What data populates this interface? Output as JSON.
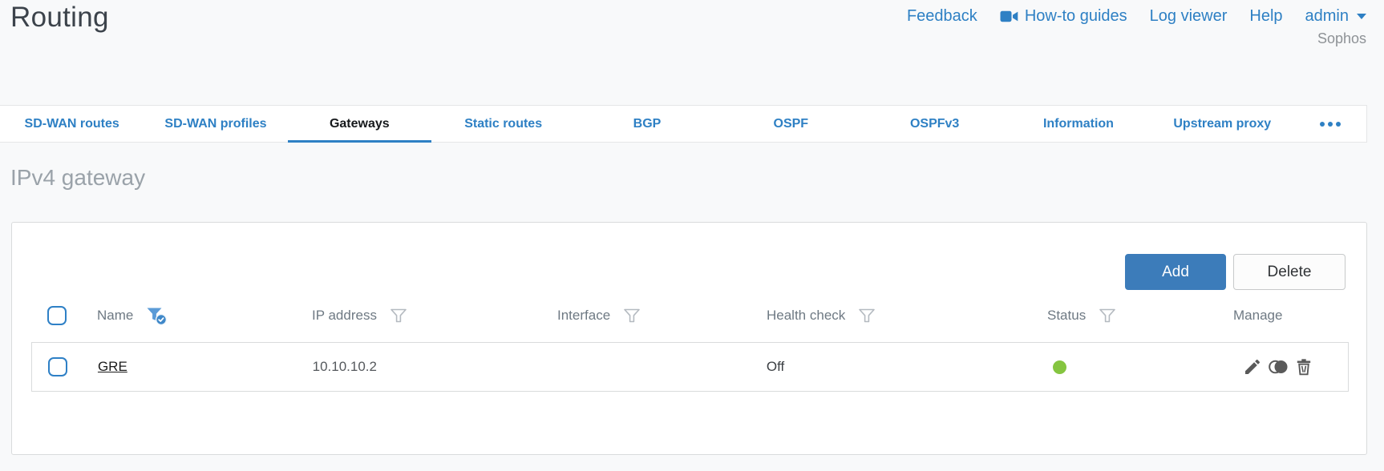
{
  "colors": {
    "accent_blue": "#2e80c4",
    "add_button_blue": "#3c7cba",
    "status_green": "#85c540"
  },
  "header": {
    "title": "Routing",
    "links": {
      "feedback": "Feedback",
      "howto_guides": "How-to guides",
      "log_viewer": "Log viewer",
      "help": "Help",
      "user": "admin"
    },
    "brand": "Sophos"
  },
  "tabs": {
    "items": [
      {
        "label": "SD-WAN routes",
        "active": false
      },
      {
        "label": "SD-WAN profiles",
        "active": false
      },
      {
        "label": "Gateways",
        "active": true
      },
      {
        "label": "Static routes",
        "active": false
      },
      {
        "label": "BGP",
        "active": false
      },
      {
        "label": "OSPF",
        "active": false
      },
      {
        "label": "OSPFv3",
        "active": false
      },
      {
        "label": "Information",
        "active": false
      },
      {
        "label": "Upstream proxy",
        "active": false
      }
    ],
    "more_icon": "ellipsis"
  },
  "section": {
    "heading": "IPv4 gateway"
  },
  "toolbar": {
    "add_label": "Add",
    "delete_label": "Delete"
  },
  "table": {
    "columns": [
      {
        "label": "Name",
        "filter": "active"
      },
      {
        "label": "IP address",
        "filter": "inactive"
      },
      {
        "label": "Interface",
        "filter": "inactive"
      },
      {
        "label": "Health check",
        "filter": "inactive"
      },
      {
        "label": "Status",
        "filter": "inactive"
      },
      {
        "label": "Manage",
        "filter": "none"
      }
    ],
    "rows": [
      {
        "name": "GRE",
        "ip_address": "10.10.10.2",
        "interface": "",
        "health_check": "Off",
        "status": "green",
        "actions": [
          "edit",
          "clone",
          "delete"
        ]
      }
    ]
  }
}
